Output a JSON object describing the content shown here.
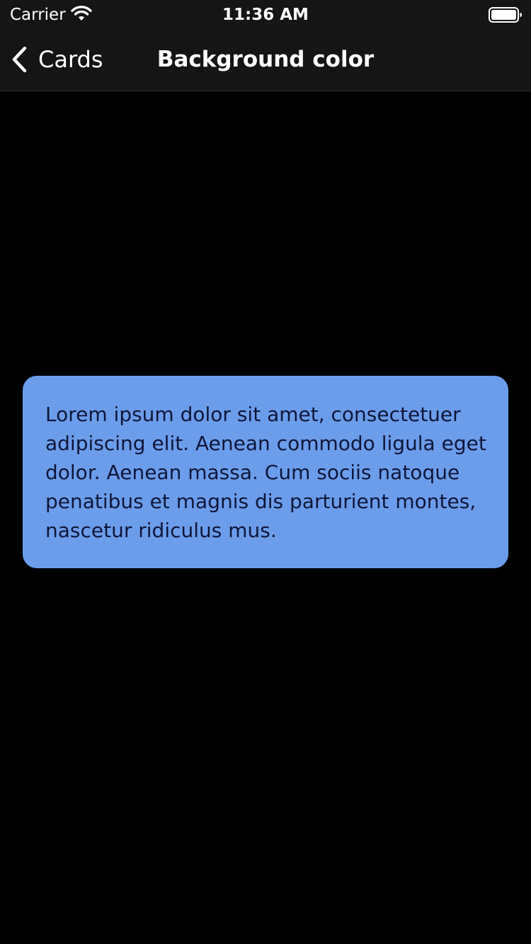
{
  "status_bar": {
    "carrier": "Carrier",
    "time": "11:36 AM",
    "wifi_icon": "wifi-icon",
    "battery_icon": "battery-icon"
  },
  "nav_bar": {
    "back_label": "Cards",
    "back_icon": "chevron-left-icon",
    "title": "Background color"
  },
  "card": {
    "text": "Lorem ipsum dolor sit amet, consectetuer adipiscing elit. Aenean commodo ligula eget dolor. Aenean massa. Cum sociis natoque penatibus et magnis dis parturient montes, nascetur ridiculus mus.",
    "background_color": "#6c9deb",
    "text_color": "#0f1638"
  },
  "colors": {
    "screen_background": "#000000",
    "nav_background": "#151515",
    "nav_text": "#ffffff"
  }
}
